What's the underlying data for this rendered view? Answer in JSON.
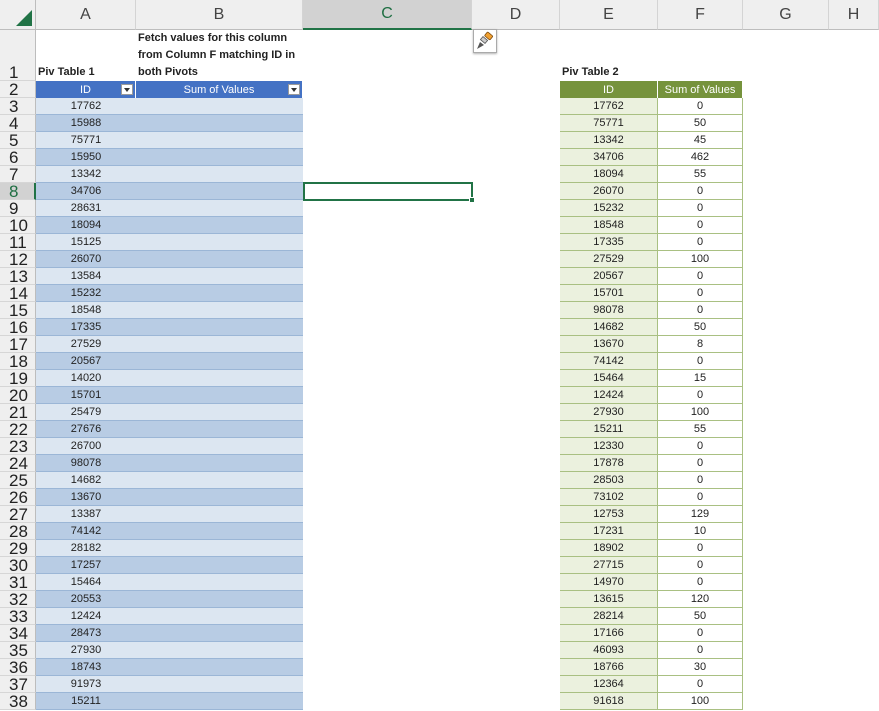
{
  "columns": [
    "A",
    "B",
    "C",
    "D",
    "E",
    "F",
    "G",
    "H"
  ],
  "selected_column": "C",
  "selected_row": 8,
  "icons": {
    "format_painter": "paintbrush-icon",
    "select_all": "select-all-icon"
  },
  "colors": {
    "pivot1_header": "#4472c4",
    "pivot2_header": "#76933c",
    "selection": "#217346"
  },
  "pivot1": {
    "title": "Piv Table 1",
    "headers": [
      "ID",
      "Sum of Values"
    ],
    "ids": [
      "17762",
      "15988",
      "75771",
      "15950",
      "13342",
      "34706",
      "28631",
      "18094",
      "15125",
      "26070",
      "13584",
      "15232",
      "18548",
      "17335",
      "27529",
      "20567",
      "14020",
      "15701",
      "25479",
      "27676",
      "26700",
      "98078",
      "14682",
      "13670",
      "13387",
      "74142",
      "28182",
      "17257",
      "15464",
      "20553",
      "12424",
      "28473",
      "27930",
      "18743",
      "91973",
      "15211"
    ]
  },
  "note": {
    "line1": "Fetch values for this column",
    "line2": "from Column F matching ID in",
    "line3": "both Pivots"
  },
  "pivot2": {
    "title": "Piv Table 2",
    "headers": [
      "ID",
      "Sum of Values"
    ],
    "rows": [
      [
        "17762",
        "0"
      ],
      [
        "75771",
        "50"
      ],
      [
        "13342",
        "45"
      ],
      [
        "34706",
        "462"
      ],
      [
        "18094",
        "55"
      ],
      [
        "26070",
        "0"
      ],
      [
        "15232",
        "0"
      ],
      [
        "18548",
        "0"
      ],
      [
        "17335",
        "0"
      ],
      [
        "27529",
        "100"
      ],
      [
        "20567",
        "0"
      ],
      [
        "15701",
        "0"
      ],
      [
        "98078",
        "0"
      ],
      [
        "14682",
        "50"
      ],
      [
        "13670",
        "8"
      ],
      [
        "74142",
        "0"
      ],
      [
        "15464",
        "15"
      ],
      [
        "12424",
        "0"
      ],
      [
        "27930",
        "100"
      ],
      [
        "15211",
        "55"
      ],
      [
        "12330",
        "0"
      ],
      [
        "17878",
        "0"
      ],
      [
        "28503",
        "0"
      ],
      [
        "73102",
        "0"
      ],
      [
        "12753",
        "129"
      ],
      [
        "17231",
        "10"
      ],
      [
        "18902",
        "0"
      ],
      [
        "27715",
        "0"
      ],
      [
        "14970",
        "0"
      ],
      [
        "13615",
        "120"
      ],
      [
        "28214",
        "50"
      ],
      [
        "17166",
        "0"
      ],
      [
        "46093",
        "0"
      ],
      [
        "18766",
        "30"
      ],
      [
        "12364",
        "0"
      ],
      [
        "91618",
        "100"
      ]
    ]
  }
}
